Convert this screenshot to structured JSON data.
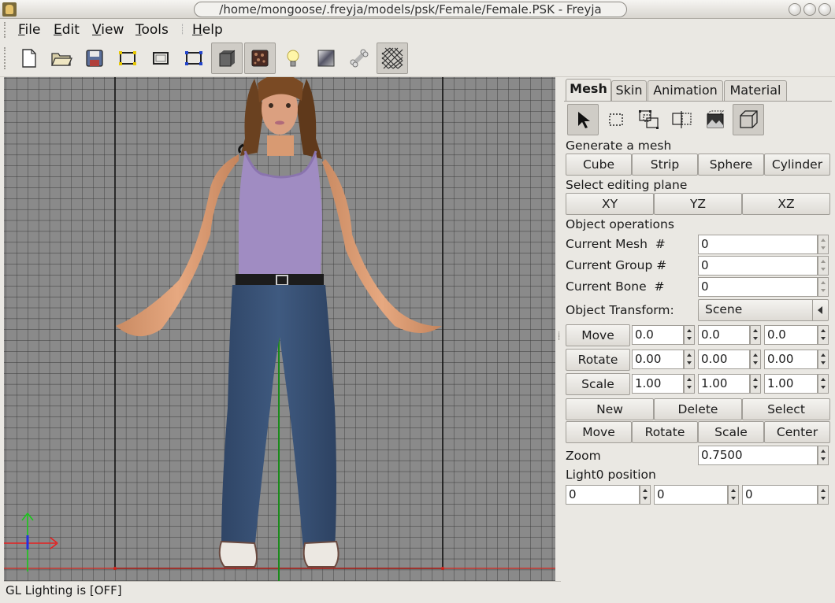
{
  "window": {
    "title": "/home/mongoose/.freyja/models/psk/Female/Female.PSK - Freyja"
  },
  "menu": [
    "File",
    "Edit",
    "View",
    "Tools",
    "Help"
  ],
  "toolbar": {
    "icons": [
      "new-file-icon",
      "open-folder-icon",
      "save-icon",
      "select-frame-yellow-icon",
      "frame-icon",
      "select-frame-blue-icon",
      "solid-shading-icon",
      "texture-icon",
      "light-bulb-icon",
      "material-icon",
      "bone-icon",
      "grid-icon"
    ],
    "pressed": [
      "solid-shading-icon",
      "texture-icon",
      "grid-icon"
    ]
  },
  "status": "GL Lighting is [OFF]",
  "panel": {
    "tabs": [
      "Mesh",
      "Skin",
      "Animation",
      "Material"
    ],
    "active_tab": "Mesh",
    "section_generate": "Generate a mesh",
    "generate_buttons": [
      "Cube",
      "Strip",
      "Sphere",
      "Cylinder"
    ],
    "section_plane": "Select editing plane",
    "plane_buttons": [
      "XY",
      "YZ",
      "XZ"
    ],
    "section_object": "Object operations",
    "current_mesh_label": "Current Mesh  #",
    "current_mesh_value": "0",
    "current_group_label": "Current Group #",
    "current_group_value": "0",
    "current_bone_label": "Current Bone  #",
    "current_bone_value": "0",
    "transform_label": "Object Transform:",
    "transform_value": "Scene",
    "move_label": "Move",
    "move_values": [
      "0.0",
      "0.0",
      "0.0"
    ],
    "rotate_label": "Rotate",
    "rotate_values": [
      "0.00",
      "0.00",
      "0.00"
    ],
    "scale_label": "Scale",
    "scale_values": [
      "1.00",
      "1.00",
      "1.00"
    ],
    "ops_row1": [
      "New",
      "Delete",
      "Select"
    ],
    "ops_row2": [
      "Move",
      "Rotate",
      "Scale",
      "Center"
    ],
    "zoom_label": "Zoom",
    "zoom_value": "0.7500",
    "light_label": "Light0 position",
    "light_values": [
      "0",
      "0",
      "0"
    ]
  }
}
